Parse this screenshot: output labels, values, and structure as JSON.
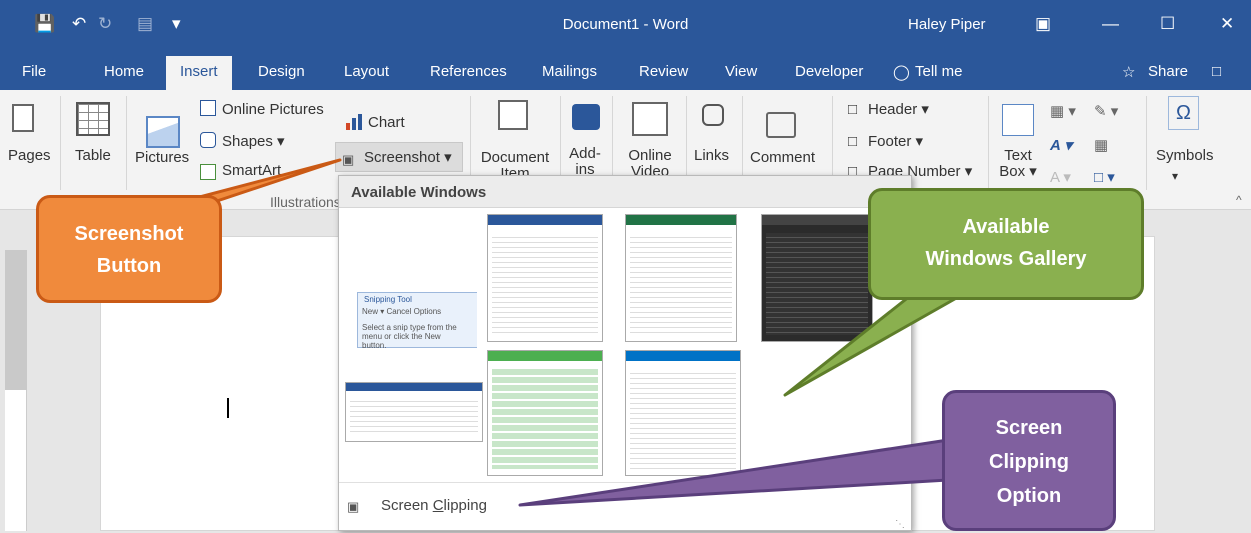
{
  "titlebar": {
    "title": "Document1  -  Word",
    "user": "Haley Piper"
  },
  "tabs": [
    "File",
    "Home",
    "Insert",
    "Design",
    "Layout",
    "References",
    "Mailings",
    "Review",
    "View",
    "Developer",
    "Tell me",
    "Share"
  ],
  "ribbon": {
    "pages": "Pages",
    "table": "Table",
    "pictures": "Pictures",
    "online_pictures": "Online Pictures",
    "shapes": "Shapes",
    "shapes_caret": "▾",
    "smartart": "SmartArt",
    "chart": "Chart",
    "screenshot": "Screenshot",
    "screenshot_caret": "▾",
    "illustrations": "Illustrations",
    "document_item_1": "Document",
    "document_item_2": "Item",
    "addins_1": "Add-",
    "addins_2": "ins",
    "online_video_1": "Online",
    "online_video_2": "Video",
    "links": "Links",
    "comment": "Comment",
    "header": "Header",
    "footer": "Footer",
    "page_number": "Page Number",
    "text_box_1": "Text",
    "text_box_2": "Box",
    "symbols": "Symbols",
    "symbol_glyph": "Ω"
  },
  "dropdown": {
    "heading": "Available Windows",
    "clip_pre": "Screen ",
    "clip_u": "C",
    "clip_post": "lipping",
    "snip": {
      "title": "Snipping Tool",
      "tools": "New ▾   Cancel   Options",
      "text": "Select a snip type from the menu or click the New button."
    }
  },
  "callouts": {
    "screenshot": [
      "Screenshot",
      "Button"
    ],
    "gallery": [
      "Available",
      "Windows Gallery"
    ],
    "clipping": [
      "Screen",
      "Clipping",
      "Option"
    ]
  },
  "colors": {
    "brand": "#2b579a",
    "orange": "#f08a3c",
    "green": "#8ab04f",
    "purple": "#80609f"
  },
  "icons": [
    "save-icon",
    "undo-icon",
    "redo-icon",
    "restore-icon",
    "minimize-icon",
    "maximize-icon",
    "close-icon",
    "lightbulb-icon",
    "share-icon",
    "comment-icon",
    "camera-icon"
  ]
}
